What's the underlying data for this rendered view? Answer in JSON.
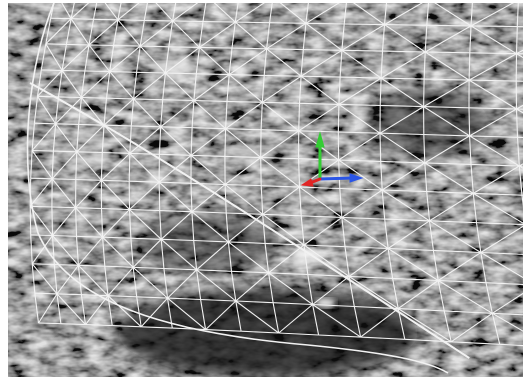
{
  "viewport": {
    "background_color": "#3a3a3a",
    "content": "ultrasound-volume-slice",
    "overlay": "wireframe-surface-mesh",
    "mesh_color": "#f2f2f2"
  },
  "gizmo": {
    "x_axis_color": "#2a55e6",
    "y_axis_color": "#33cc33",
    "z_axis_color": "#e02525",
    "icon": "transform-axes-icon"
  }
}
